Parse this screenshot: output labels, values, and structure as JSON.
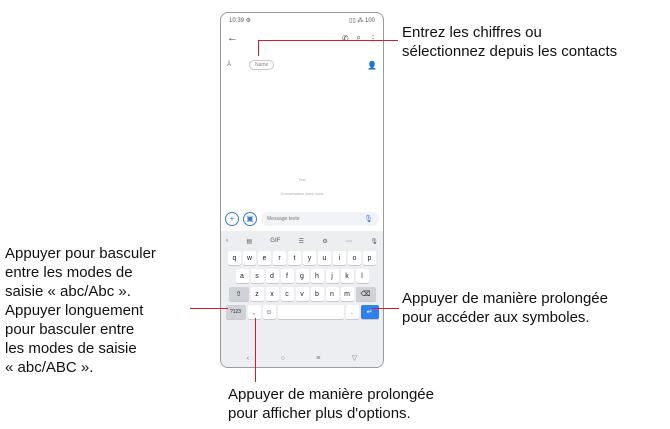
{
  "phone": {
    "status_time": "10:39 ⚙",
    "status_right": "▯▯ ⁂ 100",
    "to_label": "À",
    "recipient_chip": "Name",
    "hint_center": "Text",
    "hint_sub": "Conversation avec vous",
    "compose_placeholder": "Message texte",
    "keyboard": {
      "row1": [
        "q",
        "w",
        "e",
        "r",
        "t",
        "y",
        "u",
        "i",
        "o",
        "p"
      ],
      "row2": [
        "a",
        "s",
        "d",
        "f",
        "g",
        "h",
        "j",
        "k",
        "l"
      ],
      "row3": [
        "z",
        "x",
        "c",
        "v",
        "b",
        "n",
        "m"
      ],
      "sym_key": "?123",
      "comma_key": ",",
      "period_key": "."
    }
  },
  "icons": {
    "back": "←",
    "call": "✆",
    "search": "⌕",
    "more": "⋮",
    "add_contact": "👤",
    "attach": "+",
    "gallery": "▣",
    "mic": "🎙",
    "shift": "⇧",
    "backspace": "⌫",
    "enter": "↵",
    "emoji": "☺",
    "nav_back": "‹",
    "nav_home": "○",
    "nav_recent": "≡",
    "nav_kbd": "▽",
    "tool_left": "‹",
    "tool_clip": "▤",
    "tool_gif": "GIF",
    "tool_settings": "⚙",
    "tool_menu": "⋯",
    "tool_mic": "🎙",
    "tool_theme": "☰"
  },
  "annotations": {
    "top": [
      "Entrez les chiffres ou",
      "sélectionnez depuis les contacts"
    ],
    "left": [
      "Appuyer pour basculer",
      "entre les modes de",
      "saisie « abc/Abc ».",
      "Appuyer longuement",
      "pour basculer entre",
      "les modes de saisie",
      "« abc/ABC »."
    ],
    "right": [
      "Appuyer de manière prolongée",
      "pour accéder aux symboles."
    ],
    "bottom": [
      "Appuyer de manière prolongée",
      "pour afficher plus d'options."
    ]
  },
  "colors": {
    "callout_line": "#d11f25",
    "accent": "#2f80ed"
  }
}
